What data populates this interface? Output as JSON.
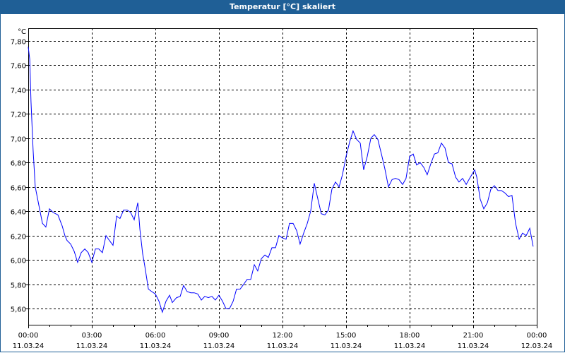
{
  "window": {
    "title": "Temperatur [°C] skaliert"
  },
  "chart_data": {
    "type": "line",
    "title": "Temperatur [°C] skaliert",
    "ylabel": "°C",
    "xlabel": "",
    "ylim": [
      5.467,
      7.904
    ],
    "xlim": [
      0,
      24
    ],
    "grid": true,
    "y_ticks": [
      "7,80",
      "7,60",
      "7,40",
      "7,20",
      "7,00",
      "6,80",
      "6,60",
      "6,40",
      "6,20",
      "6,00",
      "5,80",
      "5,60"
    ],
    "y_tick_values": [
      7.8,
      7.6,
      7.4,
      7.2,
      7.0,
      6.8,
      6.6,
      6.4,
      6.2,
      6.0,
      5.8,
      5.6
    ],
    "x_ticks": [
      {
        "time": "00:00",
        "date": "11.03.24"
      },
      {
        "time": "03:00",
        "date": "11.03.24"
      },
      {
        "time": "06:00",
        "date": "11.03.24"
      },
      {
        "time": "09:00",
        "date": "11.03.24"
      },
      {
        "time": "12:00",
        "date": "11.03.24"
      },
      {
        "time": "15:00",
        "date": "11.03.24"
      },
      {
        "time": "18:00",
        "date": "11.03.24"
      },
      {
        "time": "21:00",
        "date": "11.03.24"
      },
      {
        "time": "00:00",
        "date": "12.03.24"
      }
    ],
    "series": [
      {
        "name": "Temperatur",
        "color": "#0000ff",
        "points": [
          [
            0,
            7.75
          ],
          [
            0.07,
            7.65
          ],
          [
            0.13,
            7.3
          ],
          [
            0.23,
            6.9
          ],
          [
            0.33,
            6.6
          ],
          [
            0.5,
            6.45
          ],
          [
            0.67,
            6.3
          ],
          [
            0.83,
            6.27
          ],
          [
            1.0,
            6.42
          ],
          [
            1.17,
            6.39
          ],
          [
            1.4,
            6.37
          ],
          [
            1.6,
            6.28
          ],
          [
            1.73,
            6.2
          ],
          [
            1.83,
            6.16
          ],
          [
            2.0,
            6.13
          ],
          [
            2.17,
            6.07
          ],
          [
            2.33,
            5.98
          ],
          [
            2.5,
            6.06
          ],
          [
            2.67,
            6.09
          ],
          [
            2.83,
            6.06
          ],
          [
            3.0,
            5.98
          ],
          [
            3.17,
            6.09
          ],
          [
            3.33,
            6.09
          ],
          [
            3.5,
            6.06
          ],
          [
            3.67,
            6.2
          ],
          [
            3.83,
            6.16
          ],
          [
            4.0,
            6.12
          ],
          [
            4.17,
            6.36
          ],
          [
            4.33,
            6.34
          ],
          [
            4.5,
            6.41
          ],
          [
            4.67,
            6.41
          ],
          [
            4.83,
            6.39
          ],
          [
            5.0,
            6.33
          ],
          [
            5.17,
            6.47
          ],
          [
            5.27,
            6.25
          ],
          [
            5.4,
            6.05
          ],
          [
            5.5,
            5.95
          ],
          [
            5.67,
            5.76
          ],
          [
            5.83,
            5.74
          ],
          [
            6.0,
            5.72
          ],
          [
            6.17,
            5.66
          ],
          [
            6.33,
            5.57
          ],
          [
            6.5,
            5.66
          ],
          [
            6.67,
            5.71
          ],
          [
            6.8,
            5.65
          ],
          [
            7.0,
            5.69
          ],
          [
            7.17,
            5.7
          ],
          [
            7.33,
            5.79
          ],
          [
            7.5,
            5.74
          ],
          [
            7.67,
            5.73
          ],
          [
            7.83,
            5.73
          ],
          [
            8.0,
            5.72
          ],
          [
            8.17,
            5.67
          ],
          [
            8.33,
            5.7
          ],
          [
            8.5,
            5.69
          ],
          [
            8.67,
            5.7
          ],
          [
            8.83,
            5.67
          ],
          [
            9.0,
            5.71
          ],
          [
            9.17,
            5.66
          ],
          [
            9.33,
            5.6
          ],
          [
            9.5,
            5.6
          ],
          [
            9.67,
            5.66
          ],
          [
            9.83,
            5.76
          ],
          [
            10.0,
            5.76
          ],
          [
            10.17,
            5.8
          ],
          [
            10.33,
            5.84
          ],
          [
            10.5,
            5.84
          ],
          [
            10.67,
            5.96
          ],
          [
            10.83,
            5.91
          ],
          [
            11.0,
            6.01
          ],
          [
            11.17,
            6.04
          ],
          [
            11.33,
            6.02
          ],
          [
            11.5,
            6.1
          ],
          [
            11.67,
            6.1
          ],
          [
            11.83,
            6.2
          ],
          [
            12.0,
            6.18
          ],
          [
            12.17,
            6.17
          ],
          [
            12.33,
            6.3
          ],
          [
            12.5,
            6.3
          ],
          [
            12.67,
            6.24
          ],
          [
            12.83,
            6.13
          ],
          [
            13.0,
            6.22
          ],
          [
            13.17,
            6.3
          ],
          [
            13.33,
            6.4
          ],
          [
            13.5,
            6.63
          ],
          [
            13.67,
            6.5
          ],
          [
            13.83,
            6.38
          ],
          [
            14.0,
            6.37
          ],
          [
            14.17,
            6.41
          ],
          [
            14.33,
            6.58
          ],
          [
            14.5,
            6.64
          ],
          [
            14.67,
            6.6
          ],
          [
            14.83,
            6.7
          ],
          [
            15.0,
            6.85
          ],
          [
            15.17,
            6.97
          ],
          [
            15.33,
            7.06
          ],
          [
            15.5,
            6.99
          ],
          [
            15.67,
            6.96
          ],
          [
            15.83,
            6.74
          ],
          [
            16.0,
            6.85
          ],
          [
            16.17,
            7.0
          ],
          [
            16.33,
            7.03
          ],
          [
            16.5,
            6.99
          ],
          [
            16.67,
            6.87
          ],
          [
            16.83,
            6.75
          ],
          [
            17.0,
            6.6
          ],
          [
            17.17,
            6.66
          ],
          [
            17.33,
            6.67
          ],
          [
            17.5,
            6.66
          ],
          [
            17.67,
            6.62
          ],
          [
            17.83,
            6.67
          ],
          [
            18.0,
            6.85
          ],
          [
            18.17,
            6.87
          ],
          [
            18.33,
            6.78
          ],
          [
            18.5,
            6.8
          ],
          [
            18.67,
            6.76
          ],
          [
            18.83,
            6.7
          ],
          [
            19.0,
            6.79
          ],
          [
            19.17,
            6.87
          ],
          [
            19.33,
            6.88
          ],
          [
            19.5,
            6.96
          ],
          [
            19.67,
            6.92
          ],
          [
            19.83,
            6.8
          ],
          [
            20.0,
            6.79
          ],
          [
            20.17,
            6.68
          ],
          [
            20.33,
            6.64
          ],
          [
            20.5,
            6.67
          ],
          [
            20.67,
            6.62
          ],
          [
            20.83,
            6.67
          ],
          [
            21.0,
            6.72
          ],
          [
            21.07,
            6.74
          ],
          [
            21.17,
            6.68
          ],
          [
            21.33,
            6.5
          ],
          [
            21.5,
            6.42
          ],
          [
            21.67,
            6.47
          ],
          [
            21.83,
            6.58
          ],
          [
            22.0,
            6.61
          ],
          [
            22.17,
            6.57
          ],
          [
            22.33,
            6.57
          ],
          [
            22.5,
            6.55
          ],
          [
            22.67,
            6.52
          ],
          [
            22.83,
            6.53
          ],
          [
            23.0,
            6.3
          ],
          [
            23.17,
            6.17
          ],
          [
            23.33,
            6.22
          ],
          [
            23.5,
            6.2
          ],
          [
            23.67,
            6.26
          ],
          [
            23.83,
            6.11
          ]
        ]
      }
    ]
  }
}
